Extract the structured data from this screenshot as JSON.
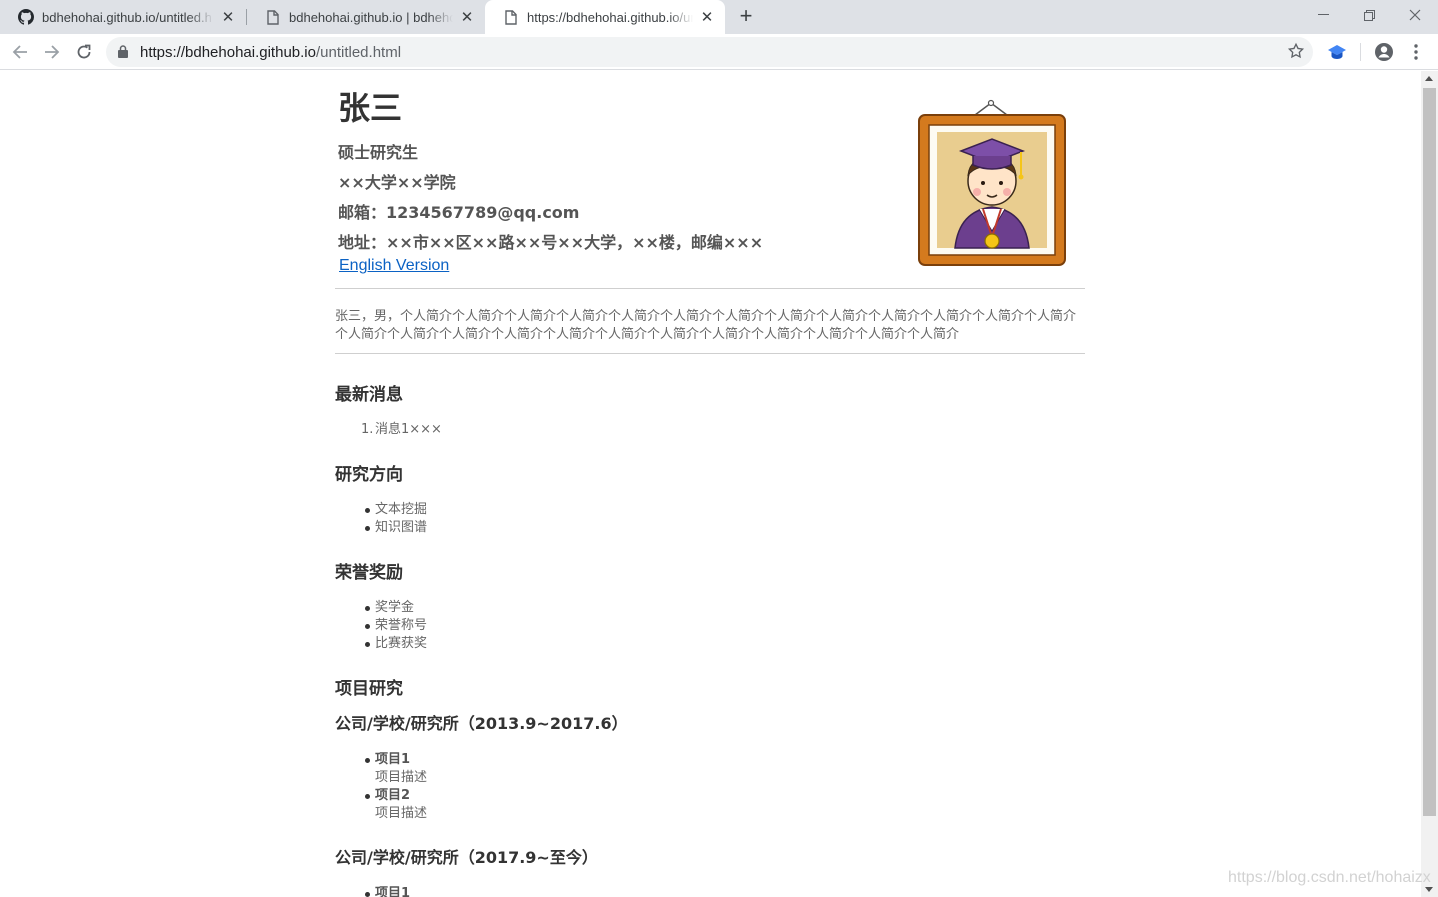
{
  "browser": {
    "tabs": [
      {
        "title": "bdhehohai.github.io/untitled.h",
        "icon": "github-icon",
        "active": false
      },
      {
        "title": "bdhehohai.github.io | bdhehoha",
        "icon": "page-icon",
        "active": false
      },
      {
        "title": "https://bdhehohai.github.io/untit",
        "icon": "page-icon",
        "active": true
      }
    ],
    "url_host": "https://bdhehohai.github.io",
    "url_path": "/untitled.html"
  },
  "profile": {
    "name": "张三",
    "degree": "硕士研究生",
    "school": "××大学××学院",
    "email": "邮箱：1234567789@qq.com",
    "address": "地址：××市××区××路××号××大学，××楼，邮编×××",
    "english_link": "English Version",
    "intro_line1": "张三，男，个人简介个人简介个人简介个人简介个人简介个人简介个人简介个人简介个人简介个人简介个人简介个人简介个人简介",
    "intro_line2": "个人简介个人简介个人简介个人简介个人简介个人简介个人简介个人简介个人简介个人简介个人简介个人简介"
  },
  "news": {
    "title": "最新消息",
    "items": [
      "消息1×××"
    ]
  },
  "research": {
    "title": "研究方向",
    "items": [
      "文本挖掘",
      "知识图谱"
    ]
  },
  "awards": {
    "title": "荣誉奖励",
    "items": [
      "奖学金",
      "荣誉称号",
      "比赛获奖"
    ]
  },
  "projects": {
    "title": "项目研究",
    "org1": "公司/学校/研究所（2013.9~2017.6）",
    "org1_items": [
      {
        "name": "项目1",
        "desc": "项目描述"
      },
      {
        "name": "项目2",
        "desc": "项目描述"
      }
    ],
    "org2": "公司/学校/研究所（2017.9~至今）",
    "org2_items": [
      {
        "name": "项目1"
      }
    ]
  },
  "watermark": "https://blog.csdn.net/hohaizx",
  "colors": {
    "link": "#0b62c4",
    "tabstrip": "#dee1e6",
    "accent_icon": "#4285f4"
  }
}
